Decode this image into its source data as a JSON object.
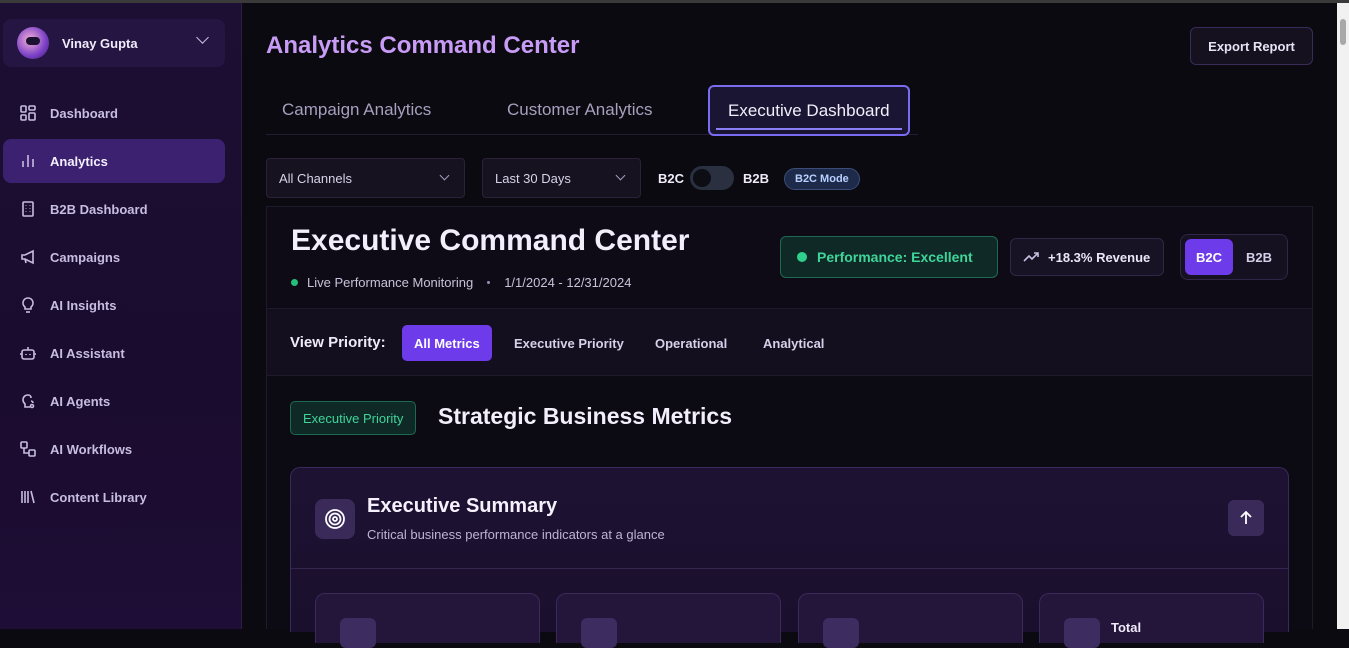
{
  "user": {
    "name": "Vinay Gupta"
  },
  "sidebar": {
    "items": [
      {
        "label": "Dashboard",
        "icon": "grid-icon"
      },
      {
        "label": "Analytics",
        "icon": "bar-chart-icon",
        "active": true
      },
      {
        "label": "B2B Dashboard",
        "icon": "building-icon"
      },
      {
        "label": "Campaigns",
        "icon": "megaphone-icon"
      },
      {
        "label": "AI Insights",
        "icon": "lightbulb-icon"
      },
      {
        "label": "AI Assistant",
        "icon": "bot-icon"
      },
      {
        "label": "AI Agents",
        "icon": "brain-icon"
      },
      {
        "label": "AI Workflows",
        "icon": "workflow-icon"
      },
      {
        "label": "Content Library",
        "icon": "library-icon"
      }
    ]
  },
  "header": {
    "title": "Analytics Command Center",
    "export_label": "Export Report"
  },
  "tabs": [
    {
      "label": "Campaign Analytics"
    },
    {
      "label": "Customer Analytics"
    },
    {
      "label": "Executive Dashboard",
      "active": true
    }
  ],
  "filters": {
    "channel": "All Channels",
    "range": "Last 30 Days",
    "toggle_left": "B2C",
    "toggle_right": "B2B",
    "mode_badge": "B2C Mode"
  },
  "executive": {
    "title": "Executive Command Center",
    "live": "Live Performance Monitoring",
    "dates": "1/1/2024 - 12/31/2024",
    "performance": "Performance: Excellent",
    "revenue": "+18.3% Revenue",
    "seg_b2c": "B2C",
    "seg_b2b": "B2B"
  },
  "priority": {
    "label": "View Priority:",
    "options": [
      "All Metrics",
      "Executive Priority",
      "Operational",
      "Analytical"
    ]
  },
  "section": {
    "badge": "Executive Priority",
    "title": "Strategic Business Metrics"
  },
  "summary": {
    "title": "Executive Summary",
    "subtitle": "Critical business performance indicators at a glance",
    "card4_title": "Total"
  },
  "colors": {
    "accent": "#6d3bea",
    "success": "#3fd49a",
    "title": "#c89cf6"
  }
}
